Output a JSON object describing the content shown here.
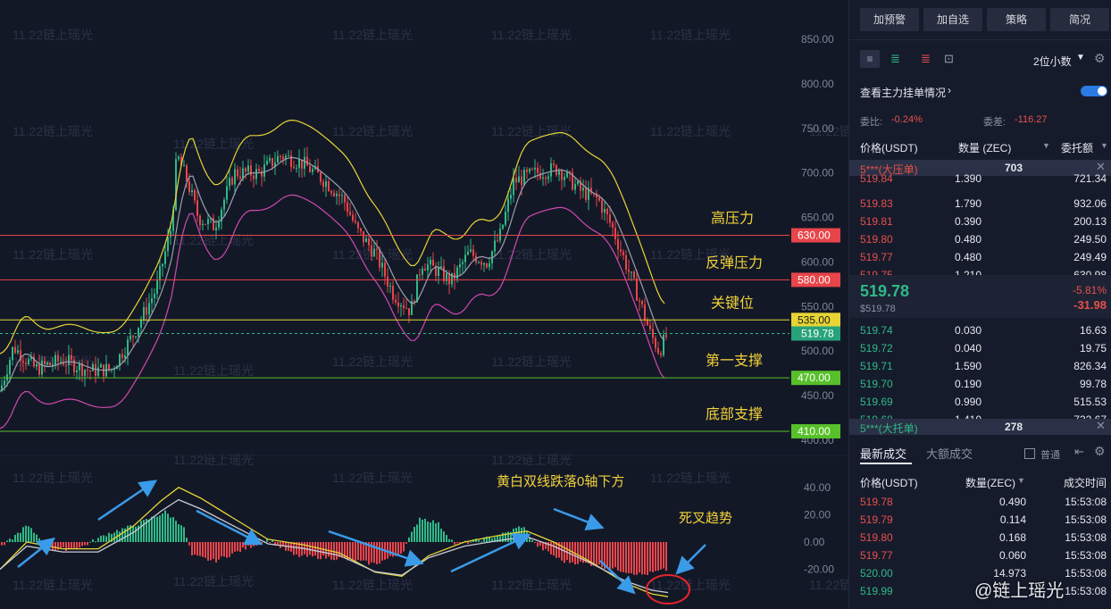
{
  "watermark": "11.22链上瑶光",
  "chart": {
    "price_ticks": [
      "850.00",
      "800.00",
      "750.00",
      "700.00",
      "650.00",
      "600.00",
      "550.00",
      "500.00",
      "450.00",
      "400.00"
    ],
    "macd_ticks": [
      "40.00",
      "20.00",
      "0.00",
      "-20.00"
    ],
    "levels": [
      {
        "value": "630.00",
        "label": "高压力",
        "color": "#e8454a"
      },
      {
        "value": "580.00",
        "label": "反弹压力",
        "color": "#e8454a"
      },
      {
        "value": "535.00",
        "label": "关键位",
        "color": "#e6d535"
      },
      {
        "value": "470.00",
        "label": "第一支撑",
        "color": "#58c02a"
      },
      {
        "value": "410.00",
        "label": "底部支撑",
        "color": "#58c02a"
      }
    ],
    "current_price_tag": "519.78",
    "annotations": {
      "macd_note": "黄白双线跌落0轴下方",
      "death_cross": "死叉趋势"
    }
  },
  "panel": {
    "buttons": [
      "加预警",
      "加自选",
      "策略",
      "简况"
    ],
    "decimals": "2位小数",
    "main_orders_label": "查看主力挂单情况",
    "ratio_label": "委比:",
    "ratio_value": "-0.24%",
    "diff_label": "委差:",
    "diff_value": "-116.27",
    "headers": {
      "price": "价格(USDT)",
      "qty": "数量 (ZEC)",
      "total": "委托额"
    },
    "ask_banner": {
      "label": "5***(大压单)",
      "qty": "703"
    },
    "asks": [
      {
        "price": "519.84",
        "qty": "1.390",
        "total": "721.34"
      },
      {
        "price": "519.83",
        "qty": "1.790",
        "total": "932.06"
      },
      {
        "price": "519.81",
        "qty": "0.390",
        "total": "200.13"
      },
      {
        "price": "519.80",
        "qty": "0.480",
        "total": "249.50"
      },
      {
        "price": "519.77",
        "qty": "0.480",
        "total": "249.49"
      },
      {
        "price": "519.75",
        "qty": "1.210",
        "total": "630.98"
      }
    ],
    "last_price": "519.78",
    "last_price_usd": "$519.78",
    "change_pct": "-5.81%",
    "change_abs": "-31.98",
    "bids": [
      {
        "price": "519.74",
        "qty": "0.030",
        "total": "16.63"
      },
      {
        "price": "519.72",
        "qty": "0.040",
        "total": "19.75"
      },
      {
        "price": "519.71",
        "qty": "1.590",
        "total": "826.34"
      },
      {
        "price": "519.70",
        "qty": "0.190",
        "total": "99.78"
      },
      {
        "price": "519.69",
        "qty": "0.990",
        "total": "515.53"
      },
      {
        "price": "519.68",
        "qty": "1.410",
        "total": "732.67"
      }
    ],
    "bid_banner": {
      "label": "5***(大托单)",
      "qty": "278"
    },
    "trades_tabs": [
      "最新成交",
      "大额成交"
    ],
    "normal_label": "普通",
    "trades_headers": {
      "price": "价格(USDT)",
      "qty": "数量(ZEC)",
      "time": "成交时间"
    },
    "trades": [
      {
        "price": "519.78",
        "qty": "0.490",
        "time": "15:53:08",
        "side": "sell"
      },
      {
        "price": "519.79",
        "qty": "0.114",
        "time": "15:53:08",
        "side": "sell"
      },
      {
        "price": "519.80",
        "qty": "0.168",
        "time": "15:53:08",
        "side": "sell"
      },
      {
        "price": "519.77",
        "qty": "0.060",
        "time": "15:53:08",
        "side": "sell"
      },
      {
        "price": "520.00",
        "qty": "14.973",
        "time": "15:53:08",
        "side": "buy"
      },
      {
        "price": "519.99",
        "qty": "",
        "time": "15:53:08",
        "side": "buy"
      }
    ],
    "brand": "@链上瑶光",
    "colors": {
      "ask": "#e6504a",
      "bid": "#2fb986",
      "accent": "#2a7be4"
    }
  }
}
